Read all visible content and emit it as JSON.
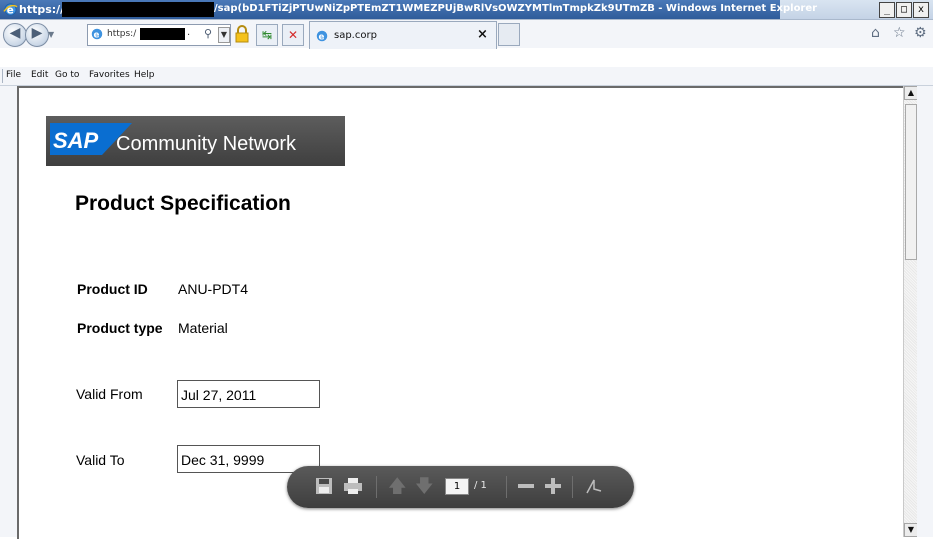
{
  "window": {
    "title_prefix": "https://",
    "title_path": "/sap(bD1FTiZjPTUwNiZpPTEmZT1WMEZPUjBwRlVsOWZYMTlmTmpkZk9UTmZB - Windows Internet Explorer",
    "buttons": [
      "_",
      "□",
      "x"
    ]
  },
  "navbar": {
    "address_text": "https:/",
    "address_suffix": ".",
    "tab_label": "sap.corp",
    "tab_close": "×"
  },
  "menu": {
    "items": [
      "File",
      "Edit",
      "Go to",
      "Favorites",
      "Help"
    ]
  },
  "page": {
    "brand_logo_text": "SAP",
    "brand_network": "Community Network",
    "title": "Product Specification",
    "product_id_label": "Product ID",
    "product_id_value": "ANU-PDT4",
    "product_type_label": "Product type",
    "product_type_value": "Material",
    "valid_from_label": "Valid From",
    "valid_from_value": "Jul 27, 2011",
    "valid_to_label": "Valid To",
    "valid_to_value": "Dec 31, 9999"
  },
  "pdf_toolbar": {
    "page_current": "1",
    "page_total": "/ 1",
    "icons": [
      "save-icon",
      "print-icon",
      "page-up-icon",
      "page-down-icon",
      "zoom-out-icon",
      "zoom-in-icon",
      "acrobat-icon"
    ]
  },
  "colors": {
    "sap_blue": "#0a6ed1",
    "title_bar": "#2f5c9a",
    "pdf_bar": "#4a4a4a"
  }
}
